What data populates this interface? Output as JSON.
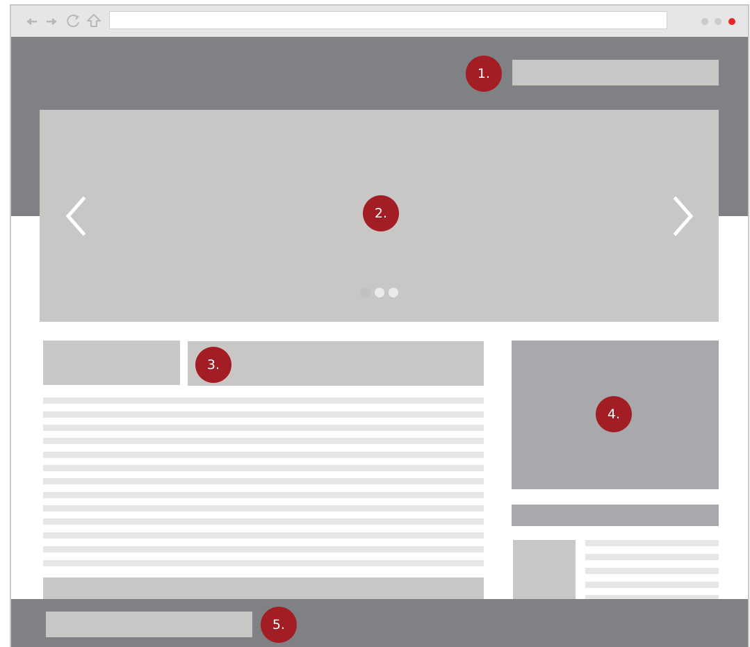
{
  "markers": {
    "m1": "1.",
    "m2": "2.",
    "m3": "3.",
    "m4": "4.",
    "m5": "5."
  },
  "browser": {
    "nav_icons": [
      "back-arrow-icon",
      "forward-arrow-icon",
      "reload-icon",
      "home-icon"
    ],
    "window_dot_colors": [
      "#cbcbcb",
      "#cbcbcb",
      "#e8262a"
    ]
  },
  "slider": {
    "nav_icons": [
      "chevron-left-icon",
      "chevron-right-icon"
    ],
    "slide_count": 3,
    "active_slide": 1
  },
  "colors": {
    "header_footer": "#808184",
    "placeholder": "#c8c7c5",
    "sidebar_block": "#a8a9ad",
    "text_line": "#e6e6e7",
    "marker": "#a21d24"
  }
}
